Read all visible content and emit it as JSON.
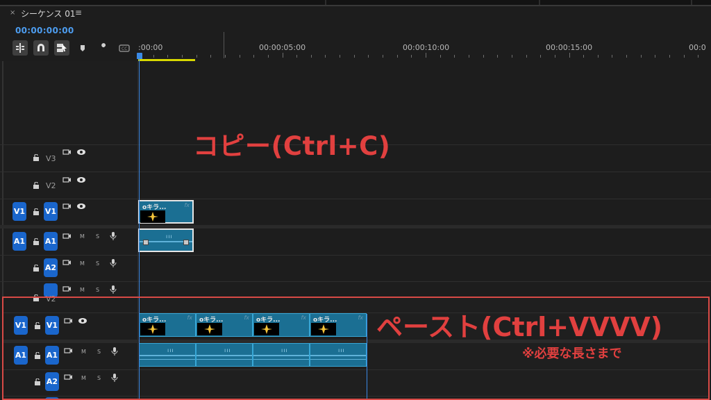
{
  "panel": {
    "close_glyph": "×",
    "title": "シーケンス 01",
    "menu_glyph": "≡",
    "timecode": "00:00:00:00"
  },
  "toolbar": {
    "tools": [
      "insert-sequence-icon",
      "snap-magnet-icon",
      "linked-selection-icon",
      "add-marker-icon",
      "settings-wrench-icon",
      "captions-icon"
    ]
  },
  "ruler": {
    "labels": [
      ":00:00",
      "00:00:05:00",
      "00:00:10:00",
      "00:00:15:00",
      "00:0"
    ]
  },
  "tracks": {
    "v3": "V3",
    "v2": "V2",
    "v1": "V1",
    "a1": "A1",
    "a2": "A2",
    "mute": "M",
    "solo": "S"
  },
  "clip": {
    "title": "oキラ...",
    "fx": "fx",
    "audio_ticks": "ııı"
  },
  "annotations": {
    "copy": "コピー(Ctrl+C)",
    "paste": "ペースト(Ctrl+VVVV)",
    "paste_note": "※必要な長さまで"
  },
  "colors": {
    "accent": "#1a66cc",
    "clip": "#1b6f93",
    "annotation": "#e1403f",
    "playhead": "#3b8ae6"
  }
}
